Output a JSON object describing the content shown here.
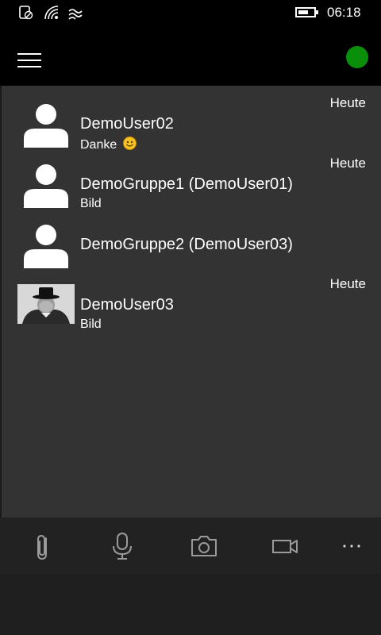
{
  "status_bar": {
    "time": "06:18",
    "icons": [
      "notification-off-icon",
      "wifi-icon",
      "network-wave-icon",
      "battery-icon"
    ]
  },
  "header": {
    "menu_icon": "hamburger-icon",
    "presence_color": "#0a8f0a"
  },
  "conversations": [
    {
      "name": "DemoUser02",
      "preview": "Danke",
      "date": "Heute",
      "avatar": "default-avatar",
      "emoji": "smiley-icon"
    },
    {
      "name": "DemoGruppe1 (DemoUser01)",
      "preview": "Bild",
      "date": "Heute",
      "avatar": "default-avatar"
    },
    {
      "name": "DemoGruppe2 (DemoUser03)",
      "preview": "",
      "date": "",
      "avatar": "default-avatar"
    },
    {
      "name": "DemoUser03",
      "preview": "Bild",
      "date": "Heute",
      "avatar": "photo-avatar"
    }
  ],
  "app_bar": {
    "buttons": [
      "attach-icon",
      "microphone-icon",
      "camera-icon",
      "video-icon",
      "more-icon"
    ]
  }
}
